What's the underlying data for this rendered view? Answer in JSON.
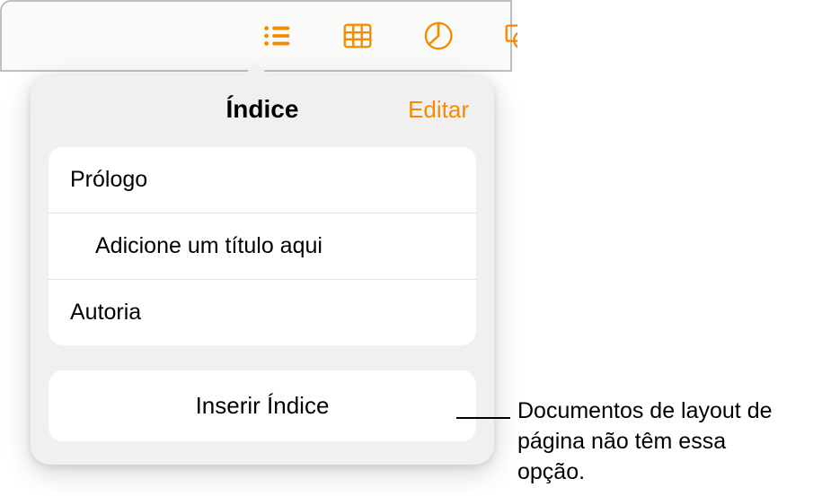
{
  "toolbar": {
    "icons": [
      "list",
      "table",
      "chart",
      "shape"
    ]
  },
  "popover": {
    "title": "Índice",
    "edit_label": "Editar",
    "toc_items": [
      {
        "label": "Prólogo",
        "indented": false
      },
      {
        "label": "Adicione um título aqui",
        "indented": true
      },
      {
        "label": "Autoria",
        "indented": false
      }
    ],
    "insert_label": "Inserir Índice"
  },
  "callout": {
    "text": "Documentos de layout de página não têm essa opção."
  },
  "colors": {
    "accent": "#f58b00"
  }
}
